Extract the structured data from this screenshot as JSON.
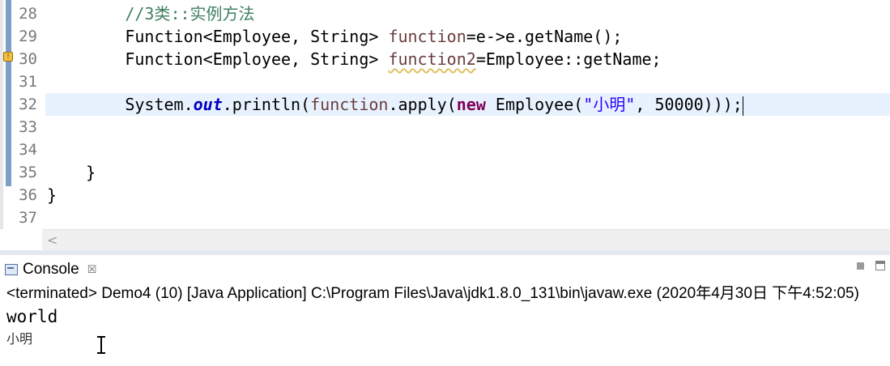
{
  "editor": {
    "lines": [
      {
        "number": "28",
        "indent": "        ",
        "comment": "//3类::实例方法"
      },
      {
        "number": "29",
        "indent": "        ",
        "type": "Function<Employee, String> ",
        "var": "function",
        "rest": "=e->e.getName();"
      },
      {
        "number": "30",
        "indent": "        ",
        "type": "Function<Employee, String> ",
        "var": "function2",
        "rest": "=Employee::getName;"
      },
      {
        "number": "31"
      },
      {
        "number": "32",
        "indent": "        ",
        "sys": "System.",
        "out": "out",
        "p1": ".println(",
        "var": "function",
        "p2": ".apply(",
        "kw": "new",
        "p3": " Employee(",
        "str": "\"小明\"",
        "p4": ", 50000)));"
      },
      {
        "number": "33"
      },
      {
        "number": "34"
      },
      {
        "number": "35",
        "text": "    }"
      },
      {
        "number": "36",
        "text": "}"
      },
      {
        "number": "37"
      }
    ],
    "scroll_left_glyph": "<"
  },
  "console": {
    "tab_label": "Console",
    "tab_close": "☒",
    "status": "<terminated> Demo4 (10) [Java Application] C:\\Program Files\\Java\\jdk1.8.0_131\\bin\\javaw.exe (2020年4月30日 下午4:52:05)",
    "output": [
      "world",
      "小明"
    ]
  }
}
